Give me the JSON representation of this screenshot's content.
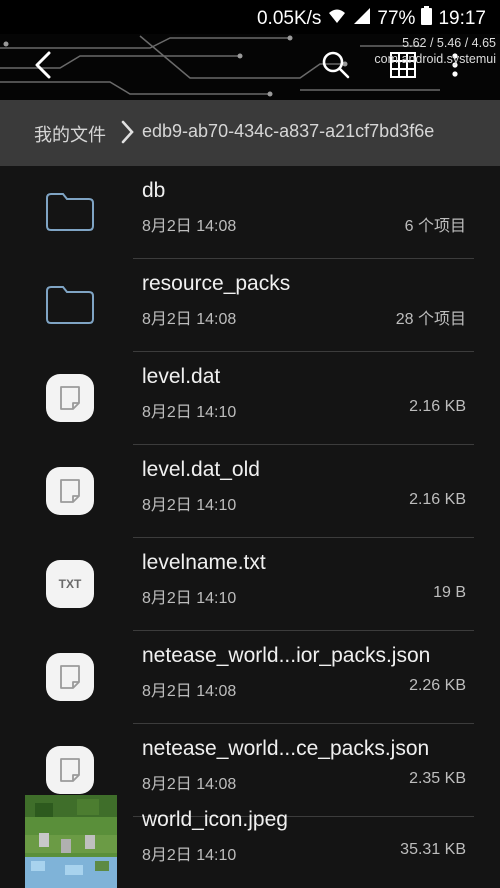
{
  "status_bar": {
    "speed": "0.05K/s",
    "battery": "77%",
    "time": "19:17"
  },
  "debug_overlay": {
    "load": "5.62 / 5.46 / 4.65",
    "process": "com.android.systemui"
  },
  "toolbar": {
    "back_icon": "chevron-left-icon",
    "search_icon": "search-icon",
    "grid_icon": "grid-view-icon",
    "more_icon": "more-vertical-icon"
  },
  "breadcrumb": {
    "root": "我的文件",
    "path": "edb9-ab70-434c-a837-a21cf7bd3f6e"
  },
  "files": [
    {
      "name": "db",
      "date": "8月2日 14:08",
      "size": "6 个项目",
      "type": "folder"
    },
    {
      "name": "resource_packs",
      "date": "8月2日 14:08",
      "size": "28 个项目",
      "type": "folder"
    },
    {
      "name": "level.dat",
      "date": "8月2日 14:10",
      "size": "2.16 KB",
      "type": "file"
    },
    {
      "name": "level.dat_old",
      "date": "8月2日 14:10",
      "size": "2.16 KB",
      "type": "file"
    },
    {
      "name": "levelname.txt",
      "date": "8月2日 14:10",
      "size": "19 B",
      "type": "txt",
      "badge": "TXT"
    },
    {
      "name": "netease_world...ior_packs.json",
      "date": "8月2日 14:08",
      "size": "2.26 KB",
      "type": "file"
    },
    {
      "name": "netease_world...ce_packs.json",
      "date": "8月2日 14:08",
      "size": "2.35 KB",
      "type": "file"
    },
    {
      "name": "world_icon.jpeg",
      "date": "8月2日 14:10",
      "size": "35.31 KB",
      "type": "image"
    }
  ]
}
